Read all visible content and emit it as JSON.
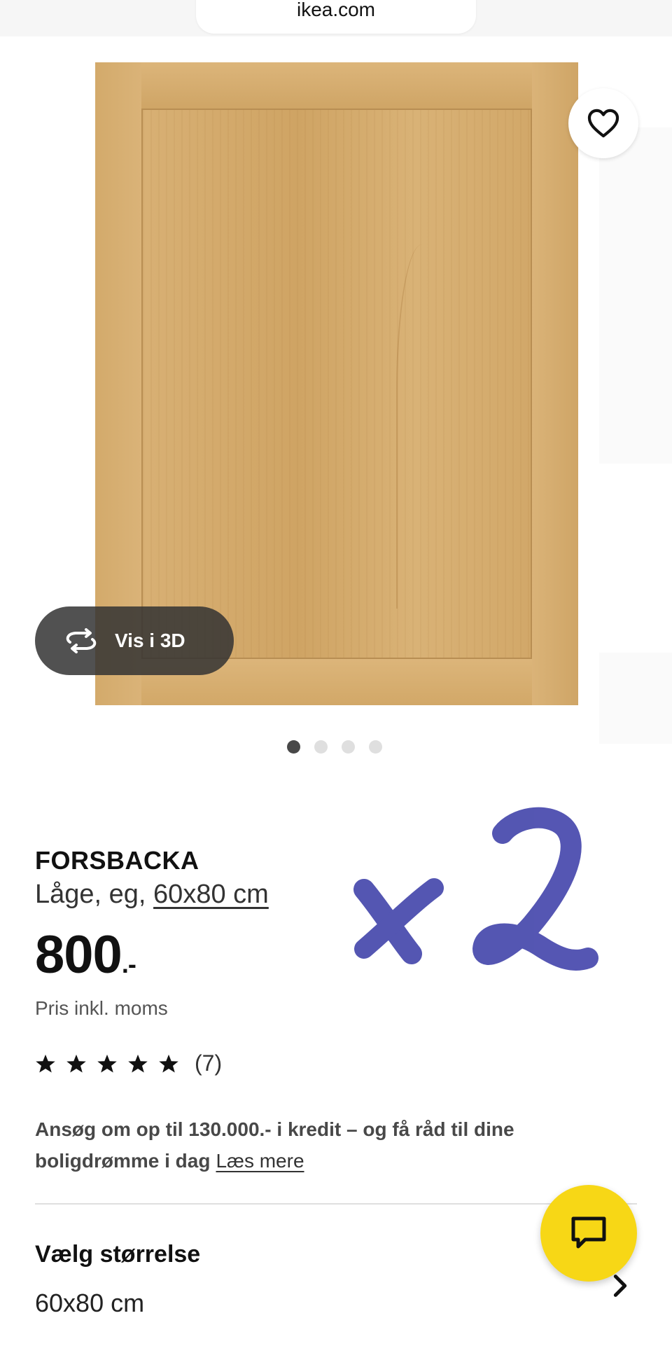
{
  "browser": {
    "url": "ikea.com"
  },
  "gallery": {
    "image_alt": "FORSBACKA door, oak",
    "view_3d_label": "Vis i 3D",
    "dots_total": 4,
    "active_dot": 1
  },
  "product": {
    "name": "FORSBACKA",
    "desc_prefix": "Låge, eg, ",
    "size_link": "60x80 cm",
    "price": "800",
    "price_suffix": ".-",
    "price_note": "Pris inkl. moms",
    "rating": {
      "stars": 5,
      "count_label": "(7)"
    },
    "credit_text": "Ansøg om op til 130.000.- i kredit – og få råd til dine boligdrømme i dag",
    "credit_link": "Læs mere"
  },
  "size_selector": {
    "title": "Vælg størrelse",
    "value": "60x80 cm"
  },
  "annotation": {
    "handwritten_text": "x2",
    "color": "#3d3fa8"
  },
  "colors": {
    "accent_yellow": "#f7d716",
    "pill_dark": "#323232",
    "wood": "#d6ae72"
  },
  "icons": {
    "favorite": "heart-icon",
    "view_3d": "rotate-3d-icon",
    "chat": "chat-icon",
    "chevron": "chevron-right-icon"
  }
}
